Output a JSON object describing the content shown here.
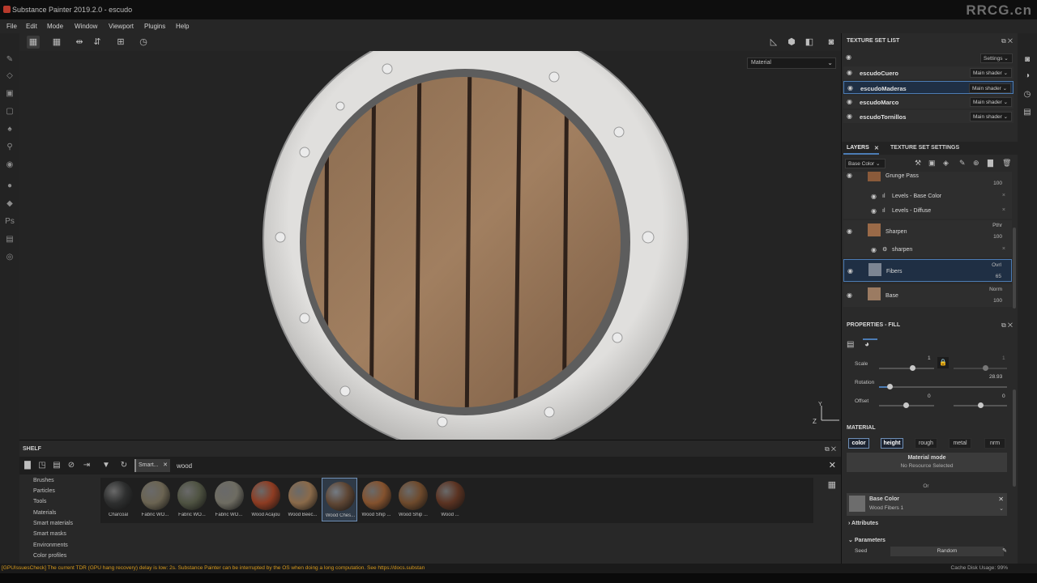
{
  "window": {
    "title": "Substance Painter 2019.2.0 - escudo",
    "watermark": "RRCG.cn"
  },
  "menu": [
    "File",
    "Edit",
    "Mode",
    "Window",
    "Viewport",
    "Plugins",
    "Help"
  ],
  "viewport": {
    "mode_select": "Material"
  },
  "shelf": {
    "title": "SHELF",
    "filter_tag": "Smart...",
    "search_value": "wood",
    "categories": [
      "Brushes",
      "Particles",
      "Tools",
      "Materials",
      "Smart materials",
      "Smart masks",
      "Environments",
      "Color profiles"
    ],
    "items": [
      {
        "label": "Charcoal",
        "color": "#2e2f2f"
      },
      {
        "label": "Fabric WO...",
        "color": "#6b6452"
      },
      {
        "label": "Fabric WO...",
        "color": "#4f5342"
      },
      {
        "label": "Fabric WO...",
        "color": "#6e6c62"
      },
      {
        "label": "Wood Acajou",
        "color": "#8e3c22"
      },
      {
        "label": "Wood Beec...",
        "color": "#8a6a4a"
      },
      {
        "label": "Wood Ches...",
        "color": "#5e4634",
        "selected": true
      },
      {
        "label": "Wood Ship ...",
        "color": "#84522e"
      },
      {
        "label": "Wood Ship ...",
        "color": "#6e4a2c"
      },
      {
        "label": "Wood ...",
        "color": "#5b3322"
      }
    ]
  },
  "status": {
    "message": "[GPUIssuesCheck] The current TDR (GPU hang recovery) delay is low: 2s. Substance Painter can be interrupted by the OS when doing a long computation. See https://docs.substan",
    "cache": "Cache Disk Usage: 99%"
  },
  "texture_set_list": {
    "title": "TEXTURE SET LIST",
    "settings_label": "Settings",
    "rows": [
      {
        "name": "escudoCuero",
        "shader": "Main shader"
      },
      {
        "name": "escudoMaderas",
        "shader": "Main shader",
        "selected": true
      },
      {
        "name": "escudoMarco",
        "shader": "Main shader"
      },
      {
        "name": "escudoTornillos",
        "shader": "Main shader"
      }
    ]
  },
  "layers_panel": {
    "tab_layers": "LAYERS",
    "tab_settings": "TEXTURE SET SETTINGS",
    "channel": "Base Color",
    "layers": [
      {
        "name": "Grunge Pass",
        "opacity": "100"
      },
      {
        "name": "Levels - Base Color"
      },
      {
        "name": "Levels - Diffuse"
      },
      {
        "name": "Sharpen",
        "blend": "Pthr",
        "opacity": "100"
      },
      {
        "name": "sharpen"
      },
      {
        "name": "Fibers",
        "blend": "Ovrl",
        "opacity": "65",
        "selected": true
      },
      {
        "name": "Base",
        "blend": "Norm",
        "opacity": "100"
      }
    ]
  },
  "properties": {
    "title": "PROPERTIES - FILL",
    "scale_label": "Scale",
    "scale_value": "1",
    "scale_value2": "1",
    "rotation_label": "Rotation",
    "rotation_value": "28.93",
    "rotation_fraction": 0.08,
    "offset_label": "Offset",
    "offset_x": "0",
    "offset_y": "0",
    "material_title": "MATERIAL",
    "material_buttons": [
      {
        "label": "color",
        "on": true
      },
      {
        "label": "height",
        "on": true
      },
      {
        "label": "rough",
        "on": false
      },
      {
        "label": "metal",
        "on": false
      },
      {
        "label": "nrm",
        "on": false
      }
    ],
    "material_mode_title": "Material mode",
    "material_mode_sub": "No Resource Selected",
    "or_label": "Or",
    "resource_name": "Base Color",
    "resource_value": "Wood Fibers 1",
    "attributes_label": "Attributes",
    "parameters_label": "Parameters",
    "seed_label": "Seed",
    "seed_value": "Random"
  }
}
